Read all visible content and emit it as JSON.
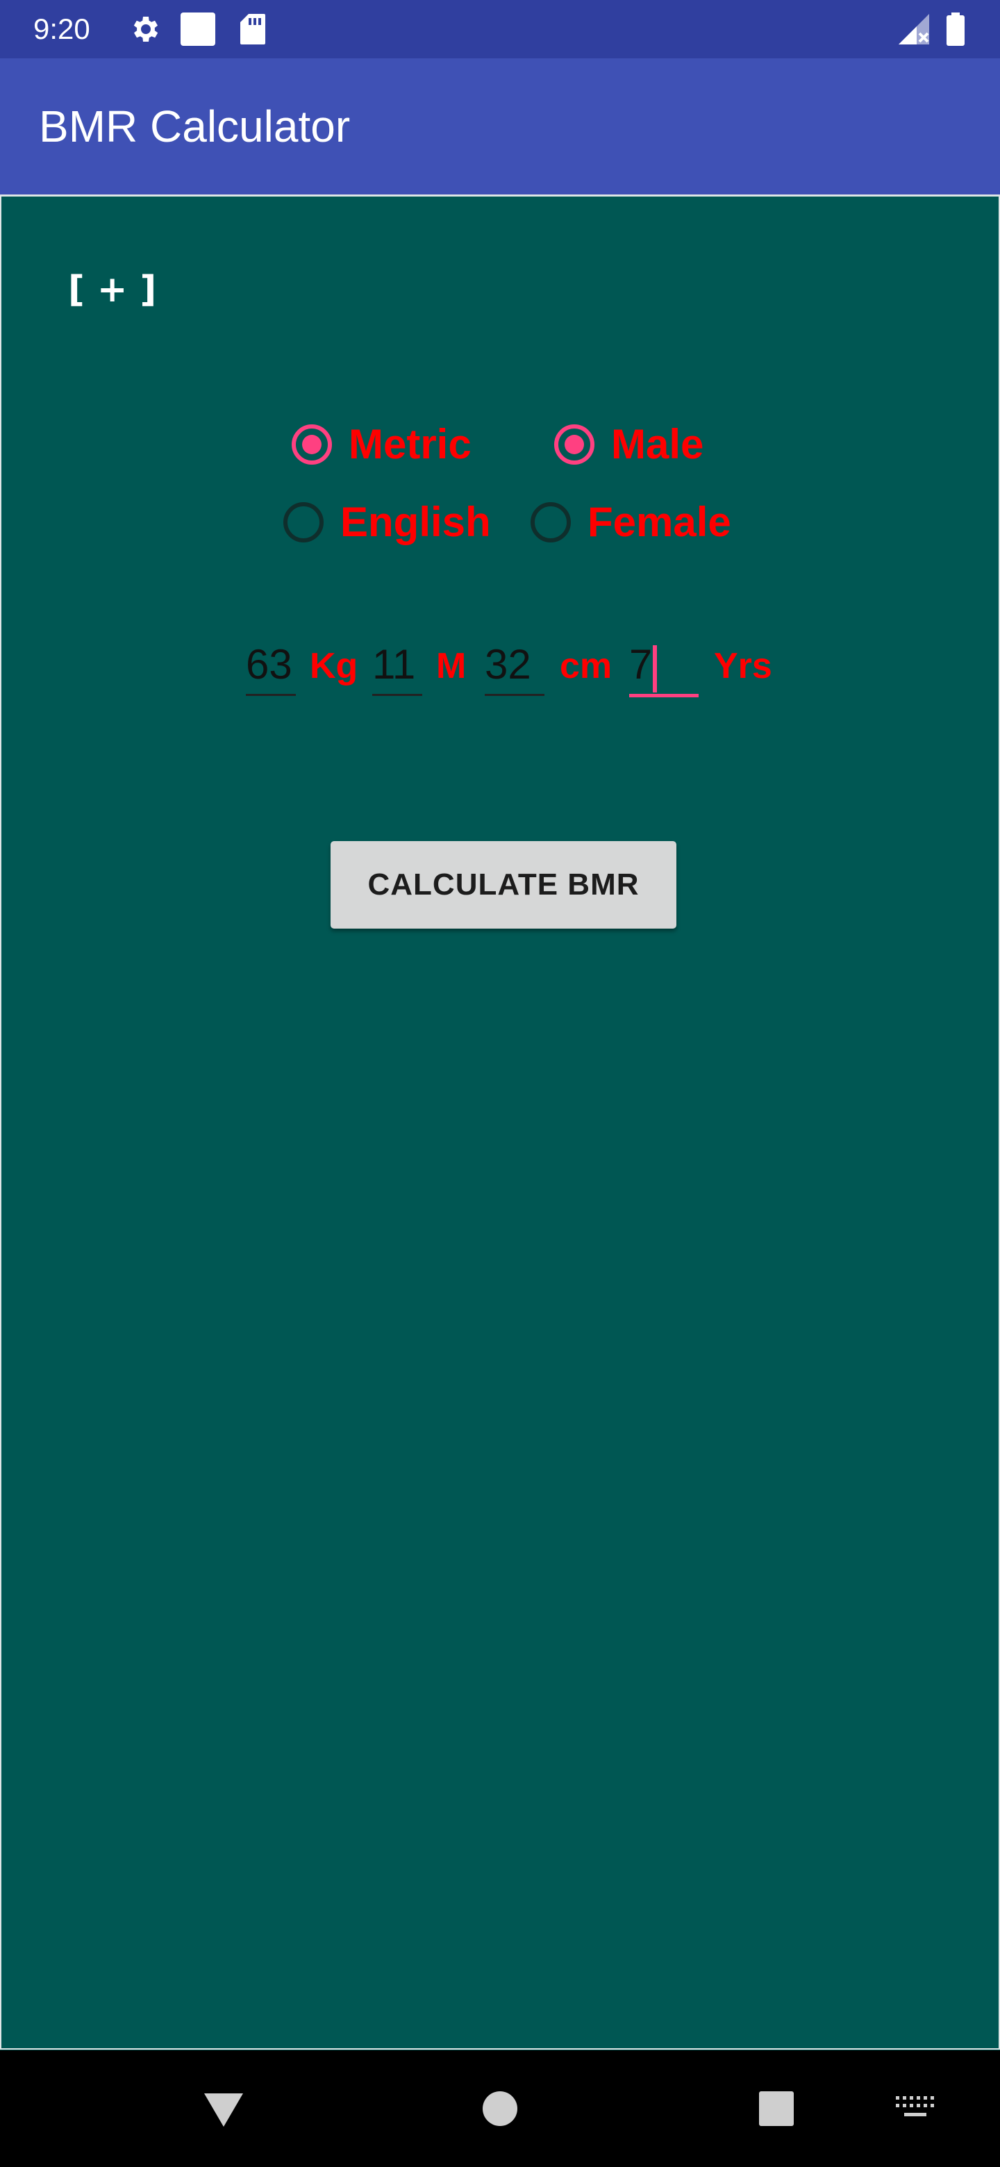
{
  "status_bar": {
    "time": "9:20",
    "icons": [
      "gear-icon",
      "square-notification-icon",
      "sd-card-icon",
      "signal-icon",
      "battery-icon"
    ]
  },
  "app_bar": {
    "title": "BMR Calculator"
  },
  "main": {
    "expand_label": "[ + ]",
    "units_options": [
      {
        "label": "Metric",
        "checked": true
      },
      {
        "label": "English",
        "checked": false
      }
    ],
    "gender_options": [
      {
        "label": "Male",
        "checked": true
      },
      {
        "label": "Female",
        "checked": false
      }
    ],
    "inputs": {
      "weight": {
        "value": "63",
        "unit": "Kg"
      },
      "height_m": {
        "value": "11",
        "unit": "M"
      },
      "height_cm": {
        "value": "32",
        "unit": "cm"
      },
      "age": {
        "value": "7",
        "unit": "Yrs"
      }
    },
    "calculate_label": "CALCULATE BMR"
  },
  "colors": {
    "status_bar": "#303F9F",
    "app_bar": "#3F51B5",
    "background": "#005753",
    "accent": "#FF4081",
    "label_red": "#FF0000"
  },
  "nav_bar": {
    "icons": [
      "back-triangle-icon",
      "home-circle-icon",
      "recents-square-icon",
      "keyboard-icon"
    ]
  }
}
